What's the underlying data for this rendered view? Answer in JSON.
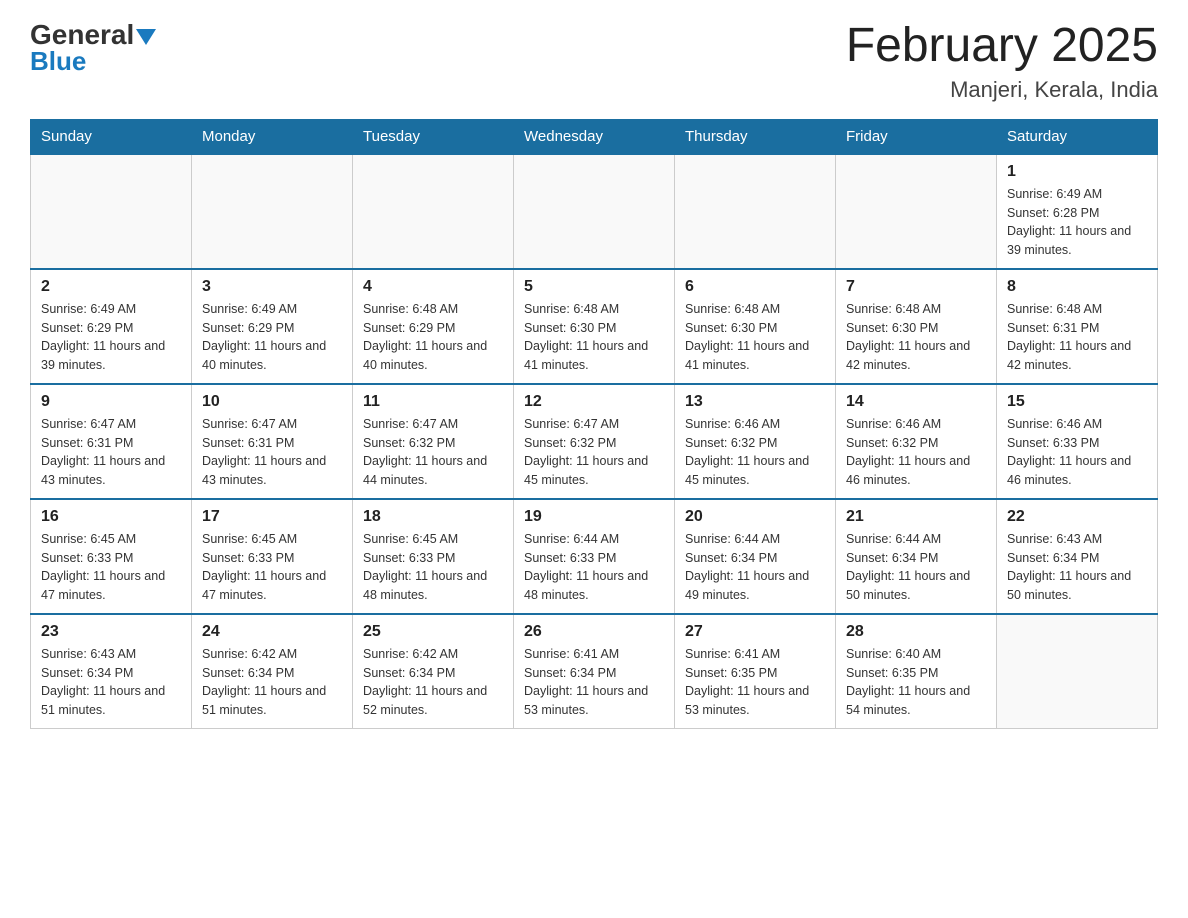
{
  "header": {
    "logo_top": "General",
    "logo_bottom": "Blue",
    "title": "February 2025",
    "subtitle": "Manjeri, Kerala, India"
  },
  "days_of_week": [
    "Sunday",
    "Monday",
    "Tuesday",
    "Wednesday",
    "Thursday",
    "Friday",
    "Saturday"
  ],
  "weeks": [
    [
      {
        "day": "",
        "info": ""
      },
      {
        "day": "",
        "info": ""
      },
      {
        "day": "",
        "info": ""
      },
      {
        "day": "",
        "info": ""
      },
      {
        "day": "",
        "info": ""
      },
      {
        "day": "",
        "info": ""
      },
      {
        "day": "1",
        "info": "Sunrise: 6:49 AM\nSunset: 6:28 PM\nDaylight: 11 hours and 39 minutes."
      }
    ],
    [
      {
        "day": "2",
        "info": "Sunrise: 6:49 AM\nSunset: 6:29 PM\nDaylight: 11 hours and 39 minutes."
      },
      {
        "day": "3",
        "info": "Sunrise: 6:49 AM\nSunset: 6:29 PM\nDaylight: 11 hours and 40 minutes."
      },
      {
        "day": "4",
        "info": "Sunrise: 6:48 AM\nSunset: 6:29 PM\nDaylight: 11 hours and 40 minutes."
      },
      {
        "day": "5",
        "info": "Sunrise: 6:48 AM\nSunset: 6:30 PM\nDaylight: 11 hours and 41 minutes."
      },
      {
        "day": "6",
        "info": "Sunrise: 6:48 AM\nSunset: 6:30 PM\nDaylight: 11 hours and 41 minutes."
      },
      {
        "day": "7",
        "info": "Sunrise: 6:48 AM\nSunset: 6:30 PM\nDaylight: 11 hours and 42 minutes."
      },
      {
        "day": "8",
        "info": "Sunrise: 6:48 AM\nSunset: 6:31 PM\nDaylight: 11 hours and 42 minutes."
      }
    ],
    [
      {
        "day": "9",
        "info": "Sunrise: 6:47 AM\nSunset: 6:31 PM\nDaylight: 11 hours and 43 minutes."
      },
      {
        "day": "10",
        "info": "Sunrise: 6:47 AM\nSunset: 6:31 PM\nDaylight: 11 hours and 43 minutes."
      },
      {
        "day": "11",
        "info": "Sunrise: 6:47 AM\nSunset: 6:32 PM\nDaylight: 11 hours and 44 minutes."
      },
      {
        "day": "12",
        "info": "Sunrise: 6:47 AM\nSunset: 6:32 PM\nDaylight: 11 hours and 45 minutes."
      },
      {
        "day": "13",
        "info": "Sunrise: 6:46 AM\nSunset: 6:32 PM\nDaylight: 11 hours and 45 minutes."
      },
      {
        "day": "14",
        "info": "Sunrise: 6:46 AM\nSunset: 6:32 PM\nDaylight: 11 hours and 46 minutes."
      },
      {
        "day": "15",
        "info": "Sunrise: 6:46 AM\nSunset: 6:33 PM\nDaylight: 11 hours and 46 minutes."
      }
    ],
    [
      {
        "day": "16",
        "info": "Sunrise: 6:45 AM\nSunset: 6:33 PM\nDaylight: 11 hours and 47 minutes."
      },
      {
        "day": "17",
        "info": "Sunrise: 6:45 AM\nSunset: 6:33 PM\nDaylight: 11 hours and 47 minutes."
      },
      {
        "day": "18",
        "info": "Sunrise: 6:45 AM\nSunset: 6:33 PM\nDaylight: 11 hours and 48 minutes."
      },
      {
        "day": "19",
        "info": "Sunrise: 6:44 AM\nSunset: 6:33 PM\nDaylight: 11 hours and 48 minutes."
      },
      {
        "day": "20",
        "info": "Sunrise: 6:44 AM\nSunset: 6:34 PM\nDaylight: 11 hours and 49 minutes."
      },
      {
        "day": "21",
        "info": "Sunrise: 6:44 AM\nSunset: 6:34 PM\nDaylight: 11 hours and 50 minutes."
      },
      {
        "day": "22",
        "info": "Sunrise: 6:43 AM\nSunset: 6:34 PM\nDaylight: 11 hours and 50 minutes."
      }
    ],
    [
      {
        "day": "23",
        "info": "Sunrise: 6:43 AM\nSunset: 6:34 PM\nDaylight: 11 hours and 51 minutes."
      },
      {
        "day": "24",
        "info": "Sunrise: 6:42 AM\nSunset: 6:34 PM\nDaylight: 11 hours and 51 minutes."
      },
      {
        "day": "25",
        "info": "Sunrise: 6:42 AM\nSunset: 6:34 PM\nDaylight: 11 hours and 52 minutes."
      },
      {
        "day": "26",
        "info": "Sunrise: 6:41 AM\nSunset: 6:34 PM\nDaylight: 11 hours and 53 minutes."
      },
      {
        "day": "27",
        "info": "Sunrise: 6:41 AM\nSunset: 6:35 PM\nDaylight: 11 hours and 53 minutes."
      },
      {
        "day": "28",
        "info": "Sunrise: 6:40 AM\nSunset: 6:35 PM\nDaylight: 11 hours and 54 minutes."
      },
      {
        "day": "",
        "info": ""
      }
    ]
  ]
}
